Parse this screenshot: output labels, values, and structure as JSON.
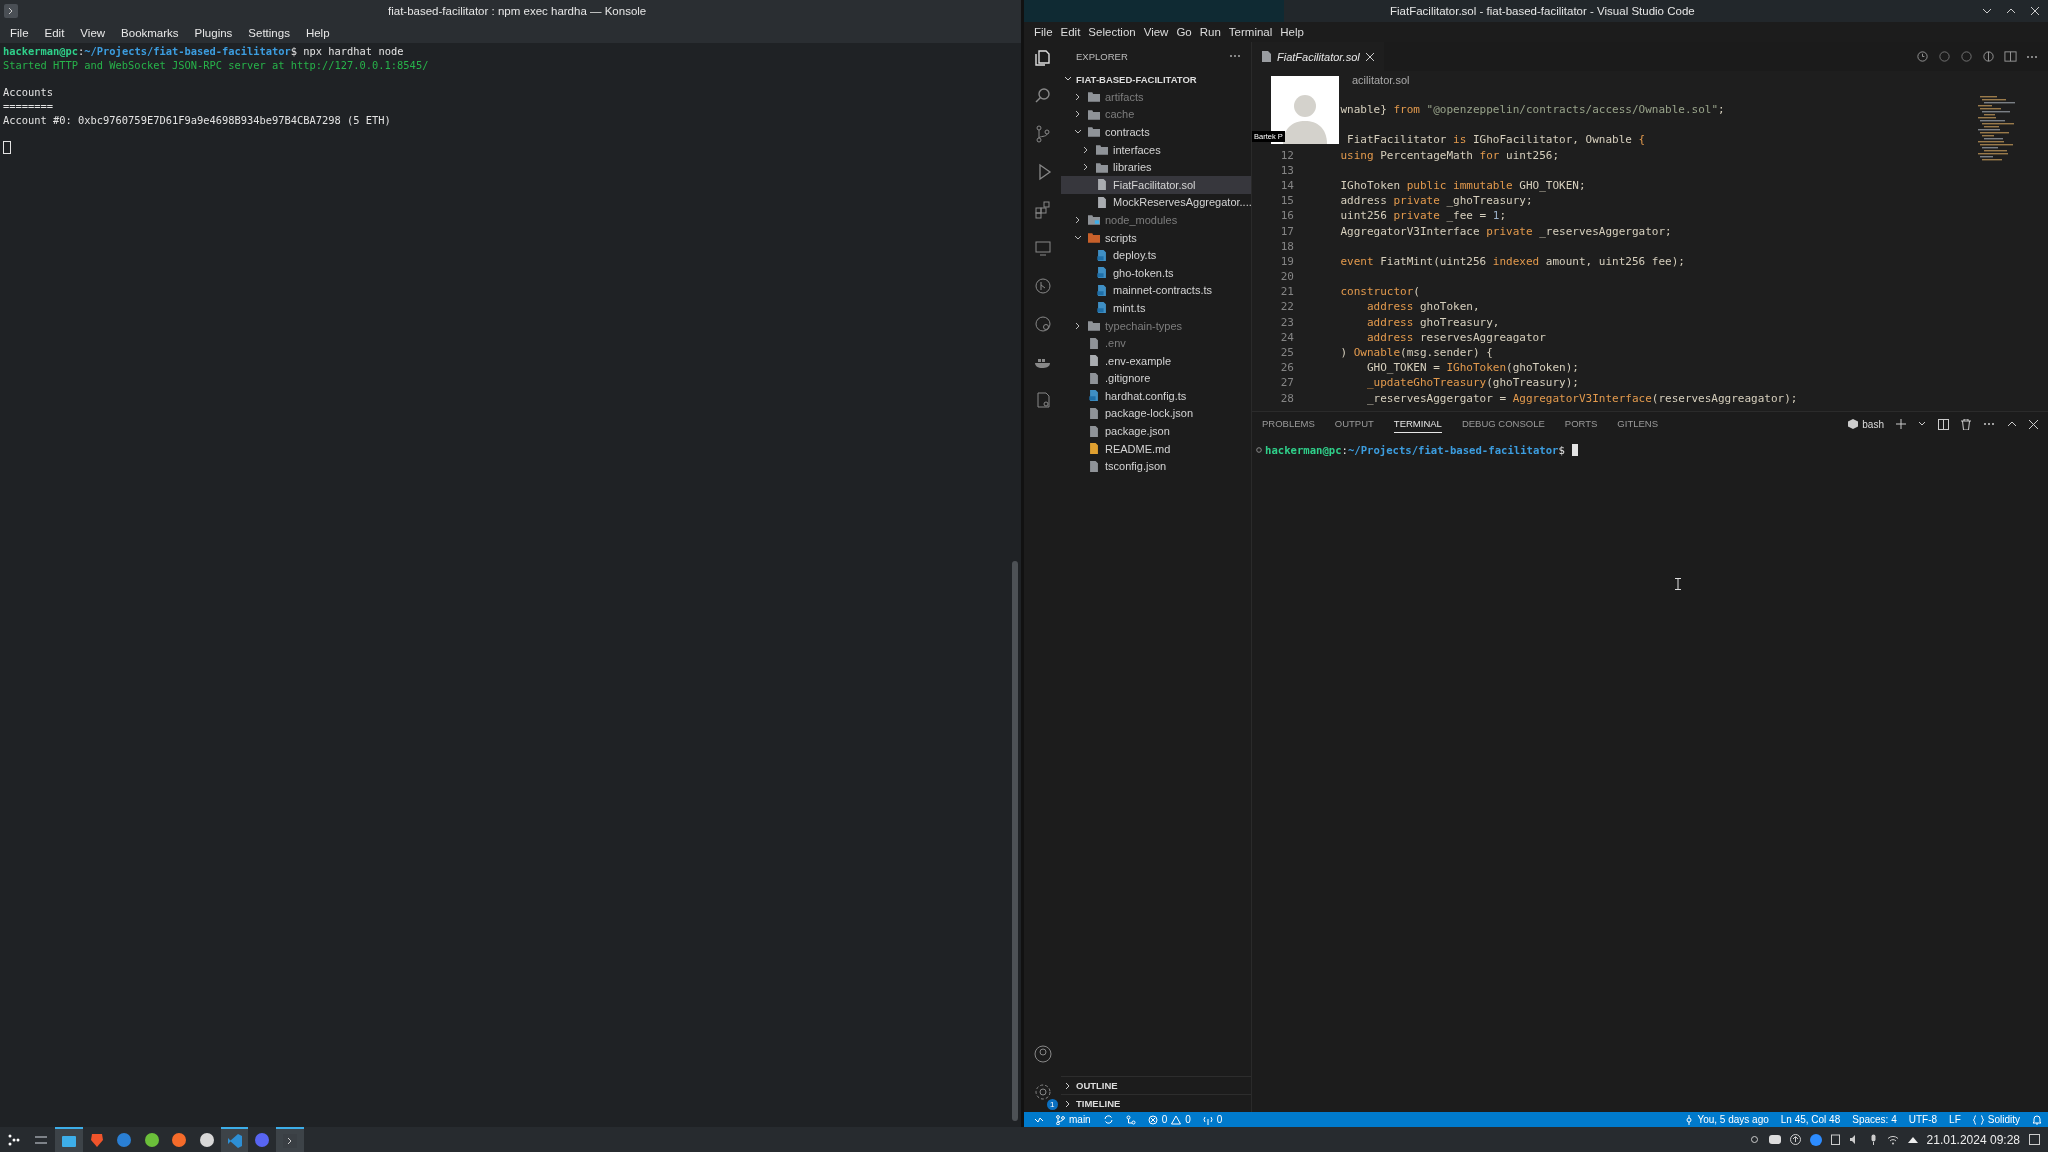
{
  "konsole": {
    "title": "fiat-based-facilitator : npm exec hardha — Konsole",
    "menu": [
      "File",
      "Edit",
      "View",
      "Bookmarks",
      "Plugins",
      "Settings",
      "Help"
    ],
    "blocks": [
      [
        [
          {
            "kind": "user",
            "text": "hackerman@pc"
          },
          {
            "kind": "plain",
            "text": ":"
          },
          {
            "kind": "path",
            "text": "~/Projects/fiat-based-facilitator"
          },
          {
            "kind": "plain",
            "text": "$ npx hardhat node"
          }
        ],
        [
          {
            "kind": "green",
            "text": "Started HTTP and WebSocket JSON-RPC server at http://127.0.0.1:8545/"
          }
        ]
      ],
      [
        [
          {
            "kind": "plain",
            "text": "Accounts"
          }
        ],
        [
          {
            "kind": "plain",
            "text": "========"
          }
        ],
        [
          {
            "kind": "plain",
            "text": "Account #0: 0xbc9760759E7D61F9a9e4698B934be97B4CBA7298 (5 ETH)"
          }
        ]
      ]
    ]
  },
  "vscode": {
    "title": "FiatFacilitator.sol - fiat-based-facilitator - Visual Studio Code",
    "menu": [
      "File",
      "Edit",
      "Selection",
      "View",
      "Go",
      "Run",
      "Terminal",
      "Help"
    ],
    "activity": {
      "settings_badge": "1"
    },
    "explorer": {
      "header": "EXPLORER",
      "root": "FIAT-BASED-FACILITATOR",
      "items": [
        {
          "name": "artifacts",
          "kind": "folder",
          "expanded": false,
          "selected": false,
          "dimmed": true
        },
        {
          "name": "cache",
          "kind": "folder",
          "expanded": false,
          "selected": false,
          "dimmed": true
        },
        {
          "name": "contracts",
          "kind": "folder",
          "expanded": true,
          "selected": false,
          "dimmed": false,
          "children": [
            {
              "name": "interfaces",
              "kind": "folder",
              "expanded": false,
              "selected": false,
              "dimmed": false
            },
            {
              "name": "libraries",
              "kind": "folder",
              "expanded": false,
              "selected": false,
              "dimmed": false
            },
            {
              "name": "FiatFacilitator.sol",
              "kind": "file",
              "selected": true,
              "dimmed": false
            },
            {
              "name": "MockReservesAggregator....",
              "kind": "file",
              "selected": false,
              "dimmed": false
            }
          ]
        },
        {
          "name": "node_modules",
          "kind": "node-folder",
          "expanded": false,
          "selected": false,
          "dimmed": true
        },
        {
          "name": "scripts",
          "kind": "script-folder",
          "expanded": true,
          "selected": false,
          "dimmed": false,
          "children": [
            {
              "name": "deploy.ts",
              "kind": "ts",
              "selected": false,
              "dimmed": false
            },
            {
              "name": "gho-token.ts",
              "kind": "ts",
              "selected": false,
              "dimmed": false
            },
            {
              "name": "mainnet-contracts.ts",
              "kind": "ts",
              "selected": false,
              "dimmed": false
            },
            {
              "name": "mint.ts",
              "kind": "ts",
              "selected": false,
              "dimmed": false
            }
          ]
        },
        {
          "name": "typechain-types",
          "kind": "folder",
          "expanded": false,
          "selected": false,
          "dimmed": true
        },
        {
          "name": ".env",
          "kind": "env",
          "selected": false,
          "dimmed": true
        },
        {
          "name": ".env-example",
          "kind": "file",
          "selected": false,
          "dimmed": false
        },
        {
          "name": ".gitignore",
          "kind": "git",
          "selected": false,
          "dimmed": false
        },
        {
          "name": "hardhat.config.ts",
          "kind": "ts",
          "selected": false,
          "dimmed": false
        },
        {
          "name": "package-lock.json",
          "kind": "json",
          "selected": false,
          "dimmed": false
        },
        {
          "name": "package.json",
          "kind": "json",
          "selected": false,
          "dimmed": false
        },
        {
          "name": "README.md",
          "kind": "md",
          "selected": false,
          "dimmed": false
        },
        {
          "name": "tsconfig.json",
          "kind": "json",
          "selected": false,
          "dimmed": false
        }
      ]
    },
    "sections": [
      "OUTLINE",
      "TIMELINE"
    ],
    "editor": {
      "tab": "FiatFacilitator.sol",
      "breadcrumb": "acilitator.sol",
      "partial_lines": [
        {
          "tokens": [
            {
              "kind": "id",
              "text": "    wnable}"
            },
            {
              "kind": "kw",
              "text": " from "
            },
            {
              "kind": "str",
              "text": "\"@openzeppelin/contracts/access/Ownable.sol\""
            },
            {
              "kind": "id",
              "text": ";"
            }
          ]
        },
        {
          "tokens": [
            {
              "kind": "id",
              "text": "     FiatFacilitator "
            },
            {
              "kind": "kw",
              "text": "is"
            },
            {
              "kind": "id",
              "text": " IGhoFacilitator, Ownable "
            },
            {
              "kind": "kw",
              "text": "{"
            }
          ]
        }
      ],
      "lines": [
        {
          "number": "12",
          "tokens": [
            {
              "kind": "kw",
              "text": "    using"
            },
            {
              "kind": "id",
              "text": " PercentageMath "
            },
            {
              "kind": "kw",
              "text": "for"
            },
            {
              "kind": "id",
              "text": " uint256;"
            }
          ]
        },
        {
          "number": "13"
        },
        {
          "number": "14",
          "tokens": [
            {
              "kind": "id",
              "text": "    IGhoToken "
            },
            {
              "kind": "kw",
              "text": "public immutable"
            },
            {
              "kind": "id",
              "text": " GHO_TOKEN;"
            }
          ]
        },
        {
          "number": "15",
          "tokens": [
            {
              "kind": "id",
              "text": "    address "
            },
            {
              "kind": "kw",
              "text": "private"
            },
            {
              "kind": "id",
              "text": " _ghoTreasury;"
            }
          ]
        },
        {
          "number": "16",
          "tokens": [
            {
              "kind": "id",
              "text": "    uint256 "
            },
            {
              "kind": "kw",
              "text": "private"
            },
            {
              "kind": "id",
              "text": " _fee = "
            },
            {
              "kind": "num",
              "text": "1"
            },
            {
              "kind": "id",
              "text": ";"
            }
          ]
        },
        {
          "number": "17",
          "tokens": [
            {
              "kind": "id",
              "text": "    AggregatorV3Interface "
            },
            {
              "kind": "kw",
              "text": "private"
            },
            {
              "kind": "id",
              "text": " _reservesAggergator;"
            }
          ]
        },
        {
          "number": "18"
        },
        {
          "number": "19",
          "tokens": [
            {
              "kind": "kw",
              "text": "    event"
            },
            {
              "kind": "id",
              "text": " FiatMint(uint256 "
            },
            {
              "kind": "kw",
              "text": "indexed"
            },
            {
              "kind": "id",
              "text": " amount, uint256 fee);"
            }
          ]
        },
        {
          "number": "20"
        },
        {
          "number": "21",
          "tokens": [
            {
              "kind": "kw",
              "text": "    constructor"
            },
            {
              "kind": "id",
              "text": "("
            }
          ]
        },
        {
          "number": "22",
          "tokens": [
            {
              "kind": "kw",
              "text": "        address"
            },
            {
              "kind": "id",
              "text": " ghoToken,"
            }
          ]
        },
        {
          "number": "23",
          "tokens": [
            {
              "kind": "kw",
              "text": "        address"
            },
            {
              "kind": "id",
              "text": " ghoTreasury,"
            }
          ]
        },
        {
          "number": "24",
          "tokens": [
            {
              "kind": "kw",
              "text": "        address"
            },
            {
              "kind": "id",
              "text": " reservesAggreagator"
            }
          ]
        },
        {
          "number": "25",
          "tokens": [
            {
              "kind": "id",
              "text": "    ) "
            },
            {
              "kind": "kw",
              "text": "Ownable"
            },
            {
              "kind": "id",
              "text": "(msg.sender) {"
            }
          ]
        },
        {
          "number": "26",
          "tokens": [
            {
              "kind": "id",
              "text": "        GHO_TOKEN = "
            },
            {
              "kind": "kw",
              "text": "IGhoToken"
            },
            {
              "kind": "id",
              "text": "(ghoToken);"
            }
          ]
        },
        {
          "number": "27",
          "tokens": [
            {
              "kind": "kw",
              "text": "        _updateGhoTreasury"
            },
            {
              "kind": "id",
              "text": "(ghoTreasury);"
            }
          ]
        },
        {
          "number": "28",
          "tokens": [
            {
              "kind": "id",
              "text": "        _reservesAggergator = "
            },
            {
              "kind": "kw",
              "text": "AggregatorV3Interface"
            },
            {
              "kind": "id",
              "text": "(reservesAggreagator);"
            }
          ]
        }
      ]
    },
    "avatar": {
      "label": "Bartek P"
    },
    "panel": {
      "tabs": [
        {
          "label": "PROBLEMS",
          "selected": false
        },
        {
          "label": "OUTPUT",
          "selected": false
        },
        {
          "label": "TERMINAL",
          "selected": true
        },
        {
          "label": "DEBUG CONSOLE",
          "selected": false
        },
        {
          "label": "PORTS",
          "selected": false
        },
        {
          "label": "GITLENS",
          "selected": false
        }
      ],
      "shell": "bash",
      "prompt": [
        {
          "kind": "user",
          "text": "hackerman@pc"
        },
        {
          "kind": "plain",
          "text": ":"
        },
        {
          "kind": "path",
          "text": "~/Projects/fiat-based-facilitator"
        },
        {
          "kind": "plain",
          "text": "$"
        }
      ]
    },
    "status_bar": {
      "branch": "main",
      "errors": "0",
      "warnings": "0",
      "ports": "0",
      "blame": "You, 5 days ago",
      "position": "Ln 45, Col 48",
      "spaces": "Spaces: 4",
      "encoding": "UTF-8",
      "eol": "LF",
      "language": "Solidity"
    }
  },
  "taskbar": {
    "apps": [
      {
        "kind": "launcher",
        "active": false
      },
      {
        "kind": "mixer",
        "active": false
      },
      {
        "kind": "files",
        "active": true
      },
      {
        "kind": "shield",
        "active": false
      },
      {
        "kind": "mail",
        "active": false
      },
      {
        "kind": "green",
        "active": false
      },
      {
        "kind": "orange",
        "active": false
      },
      {
        "kind": "grey",
        "active": false
      },
      {
        "kind": "code",
        "active": true
      },
      {
        "kind": "chat",
        "active": false
      },
      {
        "kind": "terminal",
        "active": true
      }
    ],
    "clock": "21.01.2024 09:28"
  }
}
